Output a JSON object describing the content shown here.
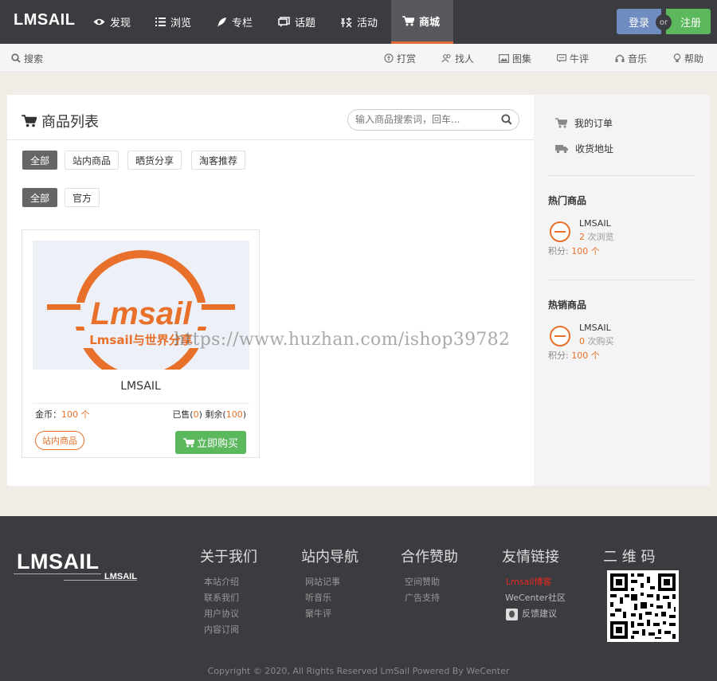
{
  "header": {
    "logo": "LMSAIL",
    "nav": [
      {
        "label": "发现",
        "icon": "eye-icon"
      },
      {
        "label": "浏览",
        "icon": "list-icon"
      },
      {
        "label": "专栏",
        "icon": "feather-icon"
      },
      {
        "label": "话题",
        "icon": "chat-icon"
      },
      {
        "label": "活动",
        "icon": "activity-icon"
      },
      {
        "label": "商城",
        "icon": "cart-icon",
        "active": true
      }
    ],
    "login_label": "登录",
    "or_label": "or",
    "register_label": "注册"
  },
  "subbar": {
    "search_label": "搜索",
    "items": [
      {
        "label": "打赏",
        "icon": "coin-icon"
      },
      {
        "label": "找人",
        "icon": "users-icon"
      },
      {
        "label": "图集",
        "icon": "image-icon"
      },
      {
        "label": "牛评",
        "icon": "comment-icon"
      },
      {
        "label": "音乐",
        "icon": "headphones-icon"
      },
      {
        "label": "帮助",
        "icon": "bulb-icon"
      }
    ]
  },
  "main": {
    "title": "商品列表",
    "search_placeholder": "输入商品搜索词，回车...",
    "filter_types": [
      "全部",
      "站内商品",
      "晒货分享",
      "淘客推荐"
    ],
    "filter_sources": [
      "全部",
      "官方"
    ],
    "product": {
      "image_text_big": "Lmsail",
      "image_text_small": "Lmsail与世界分享",
      "name": "LMSAIL",
      "price_label": "金币：",
      "price_value": "100 个",
      "sold_label": "已售(",
      "sold_value": "0",
      "remain_label": ") 剩余(",
      "remain_value": "100",
      "close_paren": ")",
      "badge": "站内商品",
      "buy_label": "立即购买"
    }
  },
  "sidebar": {
    "links": [
      {
        "label": "我的订单",
        "icon": "cart-icon"
      },
      {
        "label": "收货地址",
        "icon": "truck-icon"
      }
    ],
    "hot_title": "热门商品",
    "hot": {
      "name": "LMSAIL",
      "count": "2",
      "count_suffix": " 次浏览",
      "pts_label": "积分: ",
      "pts_value": "100 个"
    },
    "best_title": "热销商品",
    "best": {
      "name": "LMSAIL",
      "count": "0",
      "count_suffix": " 次购买",
      "pts_label": "积分: ",
      "pts_value": "100 个"
    }
  },
  "watermark": "https://www.huzhan.com/ishop39782",
  "footer": {
    "logo": "LMSAIL",
    "logo_sub": "LMSAIL",
    "columns": [
      {
        "title": "关于我们",
        "links": [
          "本站介绍",
          "联系我们",
          "用户协议",
          "内容订阅"
        ]
      },
      {
        "title": "站内导航",
        "links": [
          "网站记事",
          "听音乐",
          "聚牛评"
        ]
      },
      {
        "title": "合作赞助",
        "links": [
          "空间赞助",
          "广告支持"
        ]
      },
      {
        "title": "友情链接",
        "links": [
          "Lmsail博客",
          "WeCenter社区",
          "反馈建议"
        ]
      }
    ],
    "qr_title": "二 维 码",
    "copyright": "Copyright © 2020, All Rights Reserved LmSail Powered By WeCenter"
  },
  "colors": {
    "accent": "#e8702a",
    "green": "#5cb85c",
    "dark": "#3b3c40",
    "login": "#6e8cbf"
  }
}
